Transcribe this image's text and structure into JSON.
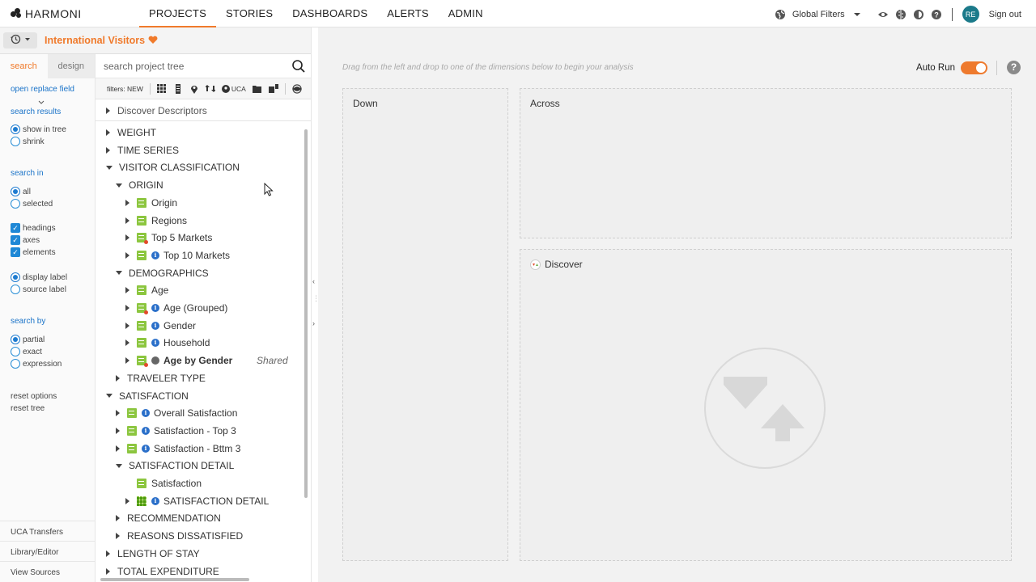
{
  "app": {
    "brand": "HARMONI"
  },
  "nav": [
    "PROJECTS",
    "STORIES",
    "DASHBOARDS",
    "ALERTS",
    "ADMIN"
  ],
  "topright": {
    "global_filters": "Global Filters",
    "avatar": "RE",
    "signout": "Sign out"
  },
  "project": {
    "title": "International Visitors"
  },
  "left": {
    "tabs": [
      "search",
      "design"
    ],
    "open_replace": "open replace field",
    "search_results_head": "search results",
    "show_in_tree": "show in tree",
    "shrink": "shrink",
    "search_in_head": "search in",
    "all": "all",
    "selected": "selected",
    "headings": "headings",
    "axes": "axes",
    "elements": "elements",
    "display_label": "display label",
    "source_label": "source label",
    "search_by_head": "search by",
    "partial": "partial",
    "exact": "exact",
    "expression": "expression",
    "reset_options": "reset options",
    "reset_tree": "reset tree",
    "uca_transfers": "UCA Transfers",
    "library_editor": "Library/Editor",
    "view_sources": "View Sources"
  },
  "tree": {
    "search_placeholder": "search project tree",
    "filters_label": "filters:",
    "filters_new": "NEW",
    "filters_uca": "UCA",
    "discover_descriptors": "Discover Descriptors",
    "nodes": [
      {
        "label": "WEIGHT",
        "level": 0,
        "state": "collapsed"
      },
      {
        "label": "TIME SERIES",
        "level": 0,
        "state": "collapsed"
      },
      {
        "label": "VISITOR CLASSIFICATION",
        "level": 0,
        "state": "expanded"
      },
      {
        "label": "ORIGIN",
        "level": 1,
        "state": "expanded"
      },
      {
        "label": "Origin",
        "level": 2,
        "state": "collapsed",
        "icon": "field"
      },
      {
        "label": "Regions",
        "level": 2,
        "state": "collapsed",
        "icon": "field"
      },
      {
        "label": "Top 5 Markets",
        "level": 2,
        "state": "collapsed",
        "icon": "field-red"
      },
      {
        "label": "Top 10 Markets",
        "level": 2,
        "state": "collapsed",
        "icon": "field",
        "info": true
      },
      {
        "label": "DEMOGRAPHICS",
        "level": 1,
        "state": "expanded"
      },
      {
        "label": "Age",
        "level": 2,
        "state": "collapsed",
        "icon": "field"
      },
      {
        "label": "Age (Grouped)",
        "level": 2,
        "state": "collapsed",
        "icon": "field-red",
        "info": true
      },
      {
        "label": "Gender",
        "level": 2,
        "state": "collapsed",
        "icon": "field",
        "info": true
      },
      {
        "label": "Household",
        "level": 2,
        "state": "collapsed",
        "icon": "field",
        "info": true
      },
      {
        "label": "Age by Gender",
        "level": 2,
        "state": "collapsed",
        "icon": "field-red",
        "shared": true,
        "bold": true
      },
      {
        "label": "TRAVELER TYPE",
        "level": 1,
        "state": "collapsed"
      },
      {
        "label": "SATISFACTION",
        "level": 0,
        "state": "expanded"
      },
      {
        "label": "Overall Satisfaction",
        "level": 1,
        "state": "collapsed",
        "icon": "field",
        "info": true
      },
      {
        "label": "Satisfaction - Top 3",
        "level": 1,
        "state": "collapsed",
        "icon": "field",
        "info": true
      },
      {
        "label": "Satisfaction - Bttm 3",
        "level": 1,
        "state": "collapsed",
        "icon": "field",
        "info": true
      },
      {
        "label": "SATISFACTION DETAIL",
        "level": 1,
        "state": "expanded"
      },
      {
        "label": "Satisfaction",
        "level": 2,
        "state": "leaf",
        "icon": "field"
      },
      {
        "label": "SATISFACTION DETAIL",
        "level": 2,
        "state": "collapsed",
        "icon": "grid",
        "info": true
      },
      {
        "label": "RECOMMENDATION",
        "level": 1,
        "state": "collapsed"
      },
      {
        "label": "REASONS DISSATISFIED",
        "level": 1,
        "state": "collapsed"
      },
      {
        "label": "LENGTH OF STAY",
        "level": 0,
        "state": "collapsed"
      },
      {
        "label": "TOTAL EXPENDITURE",
        "level": 0,
        "state": "collapsed"
      }
    ],
    "shared_tag": "Shared"
  },
  "main": {
    "hint": "Drag from the left and drop to one of the dimensions below to begin your analysis",
    "auto_run": "Auto Run",
    "down": "Down",
    "across": "Across",
    "discover": "Discover"
  }
}
